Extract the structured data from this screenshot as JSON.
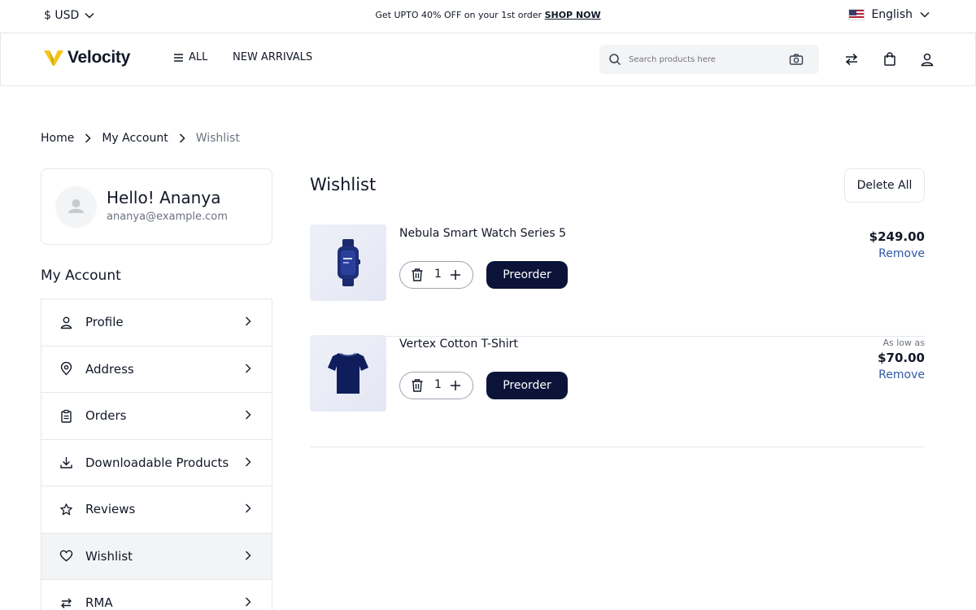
{
  "topbar": {
    "currency": "$ USD",
    "promo_text": "Get UPTO 40% OFF on your 1st order",
    "promo_link": "SHOP NOW",
    "language": "English"
  },
  "header": {
    "logo_text": "Velocity",
    "nav_all": "ALL",
    "nav_new_arrivals": "NEW ARRIVALS",
    "search_placeholder": "Search products here"
  },
  "breadcrumb": [
    "Home",
    "My Account",
    "Wishlist"
  ],
  "user": {
    "greeting": "Hello! Ananya",
    "email": "ananya@example.com"
  },
  "sidebar": {
    "title": "My Account",
    "items": [
      {
        "label": "Profile",
        "icon": "user-icon"
      },
      {
        "label": "Address",
        "icon": "location-pin-icon"
      },
      {
        "label": "Orders",
        "icon": "clipboard-icon"
      },
      {
        "label": "Downloadable Products",
        "icon": "download-icon"
      },
      {
        "label": "Reviews",
        "icon": "star-icon"
      },
      {
        "label": "Wishlist",
        "icon": "heart-icon",
        "active": true
      },
      {
        "label": "RMA",
        "icon": "exchange-icon"
      }
    ]
  },
  "wishlist": {
    "title": "Wishlist",
    "delete_all": "Delete All",
    "items": [
      {
        "name": "Nebula Smart Watch Series 5",
        "qty": "1",
        "action": "Preorder",
        "price_prefix": "",
        "price": "$249.00",
        "remove": "Remove"
      },
      {
        "name": "Vertex Cotton T-Shirt",
        "qty": "1",
        "action": "Preorder",
        "price_prefix": "As low as",
        "price": "$70.00",
        "remove": "Remove"
      }
    ]
  },
  "colors": {
    "primary_button": "#0b1438",
    "link": "#2f5aa8",
    "logo_accent": "#f5c518"
  }
}
